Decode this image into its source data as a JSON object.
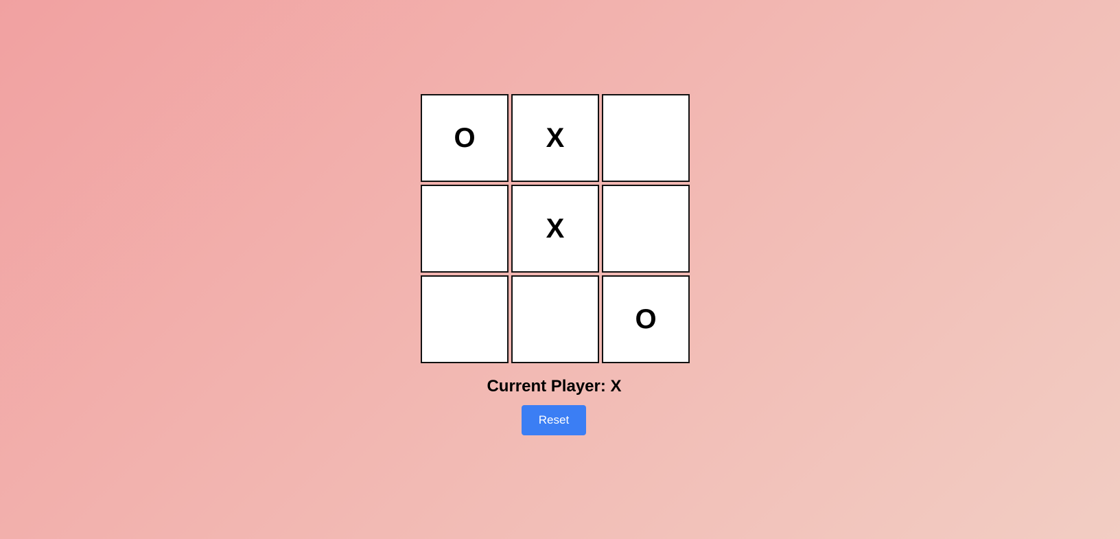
{
  "board": {
    "cells": [
      "O",
      "X",
      "",
      "",
      "X",
      "",
      "",
      "",
      "O"
    ]
  },
  "status": {
    "text": "Current Player: X"
  },
  "controls": {
    "reset_label": "Reset"
  },
  "colors": {
    "button": "#3b7ef4",
    "background_start": "#f1a1a1",
    "background_end": "#f2cdc3"
  }
}
